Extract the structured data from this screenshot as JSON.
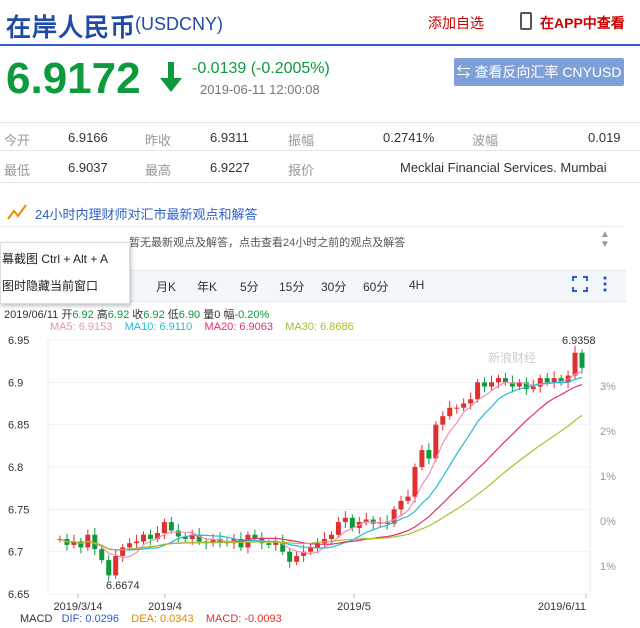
{
  "header": {
    "title": "在岸人民币",
    "code": "(USDCNY)",
    "add_watchlist": "添加自选",
    "view_in_app": "在APP中查看"
  },
  "quote": {
    "price": "6.9172",
    "change": "-0.0139 (-0.2005%)",
    "timestamp": "2019-06-11 12:00:08",
    "reverse_button": "查看反向汇率 CNYUSD"
  },
  "stats": {
    "open_label": "今开",
    "open": "6.9166",
    "prev_close_label": "昨收",
    "prev_close": "6.9311",
    "amplitude_label": "振幅",
    "amplitude": "0.2741%",
    "volatility_label": "波幅",
    "volatility": "0.019",
    "low_label": "最低",
    "low": "6.9037",
    "high_label": "最高",
    "high": "6.9227",
    "quote_label": "报价",
    "quote_source": "Mecklai Financial Services. Mumbai"
  },
  "news": {
    "title": "24小时内理财师对汇市最新观点和解答",
    "ticker": "…暂无最新观点及解答，点击查看24小时之前的观点及解答"
  },
  "context_menu": {
    "item1": "幕截图 Ctrl + Alt + A",
    "item2": "图时隐藏当前窗口"
  },
  "tabs": [
    "月K",
    "年K",
    "5分",
    "15分",
    "30分",
    "60分",
    "4H"
  ],
  "chart_info": {
    "date": "2019/06/11",
    "open_label": "开",
    "open": "6.92",
    "high_label": "高",
    "high": "6.92",
    "close_label": "收",
    "close": "6.92",
    "low_label": "低",
    "low": "6.90",
    "vol_label": "量",
    "vol": "0",
    "amp_label": "幅",
    "amp": "-0.20%",
    "ma5": "MA5: 6.9153",
    "ma10": "MA10: 6.9110",
    "ma20": "MA20: 6.9063",
    "ma30": "MA30: 6.8686"
  },
  "macd": {
    "label": "MACD",
    "dif": "DIF: 0.0296",
    "dea": "DEA: 0.0343",
    "macd": "MACD: -0.0093"
  },
  "colors": {
    "up": "#e03030",
    "down": "#0c9a3c",
    "ma5": "#f48fb1",
    "ma10": "#26b9d6",
    "ma20": "#e0306a",
    "ma30": "#a8c030"
  },
  "chart_data": {
    "type": "candlestick",
    "y_ticks": [
      "6.95",
      "6.9",
      "6.85",
      "6.8",
      "6.75",
      "6.7",
      "6.65"
    ],
    "ylim": [
      6.65,
      6.95
    ],
    "right_ticks": [
      "3%",
      "2%",
      "1%",
      "0%",
      "1%",
      "2%",
      "3%"
    ],
    "x_ticks": [
      "2019/3/14",
      "2019/4",
      "2019/5",
      "2019/6/11"
    ],
    "annotation_high": "6.9358",
    "annotation_low": "6.6674",
    "watermark": "新浪财经",
    "closes": [
      6.715,
      6.708,
      6.712,
      6.705,
      6.72,
      6.703,
      6.69,
      6.672,
      6.695,
      6.705,
      6.71,
      6.712,
      6.72,
      6.715,
      6.722,
      6.735,
      6.725,
      6.718,
      6.715,
      6.72,
      6.712,
      6.71,
      6.715,
      6.712,
      6.71,
      6.715,
      6.705,
      6.72,
      6.715,
      6.71,
      6.708,
      6.712,
      6.7,
      6.688,
      6.695,
      6.7,
      6.705,
      6.71,
      6.715,
      6.72,
      6.735,
      6.74,
      6.728,
      6.735,
      6.738,
      6.733,
      6.735,
      6.733,
      6.75,
      6.76,
      6.765,
      6.8,
      6.82,
      6.81,
      6.85,
      6.86,
      6.87,
      6.87,
      6.875,
      6.88,
      6.9,
      6.895,
      6.9,
      6.905,
      6.9,
      6.895,
      6.9,
      6.892,
      6.895,
      6.905,
      6.9,
      6.905,
      6.9,
      6.908,
      6.935,
      6.9172
    ]
  }
}
